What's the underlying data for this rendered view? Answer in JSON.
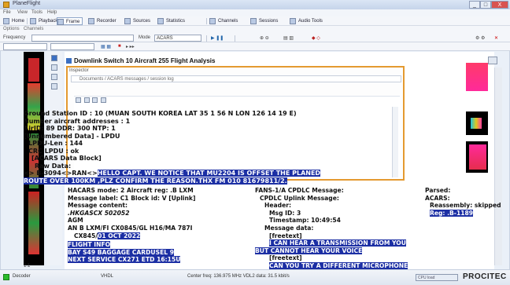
{
  "window": {
    "title": "PlaneFlight",
    "minimize": "_",
    "maximize": "□",
    "close": "X"
  },
  "menu": [
    "File",
    "View",
    "Tools",
    "Help"
  ],
  "toolbar": {
    "items": [
      "Home",
      "Playback",
      "Frame",
      "Recorder",
      "Sources",
      "Statistics",
      "Channels",
      "Sessions",
      "Audio Tools"
    ]
  },
  "toolbar2": {
    "items": [
      "Options",
      "Channels"
    ]
  },
  "toolbar3": {
    "freq_label": "Frequency",
    "mode_label": "Mode",
    "freq_value": "",
    "mode_value": "ACARS"
  },
  "toolbar4": {
    "search_placeholder": "",
    "filter_value": ""
  },
  "downlink": {
    "text": "Downlink Switch 10 Aircraft 255 Flight Analysis"
  },
  "popup": {
    "header": "Inspector",
    "path": "Documents / ACARS messages / session log"
  },
  "message": {
    "line1": "Ground Station ID : 10 (MUAN SOUTH KOREA LAT 35 1 56 N LON 126 14 19 E)",
    "line2": "Number aircraft addresses : 1",
    "line3": "AirID: 89  DDR: 300  NTP: 1",
    "line4": "[Unnumbered Data] - LPDU",
    "line5": "LPDU-Len : 144",
    "line6": "CRC LPDU : ok",
    "line7": "[ACARS Data Block]",
    "line8": "Raw Data:",
    "line9_prefix": "<> B-3094<>RAN<>",
    "line9_highlight": "HELLO CAPT. WE NOTICE THAT MU2204 IS OFFSET THE PLANED",
    "line10_highlight": "ROUTE OVER 100KM ,PLZ CONFIRM THE REASON.THX  FM 010 81679811/2."
  },
  "bottom_left": {
    "line1": "HACARS mode: 2  Aircraft reg: .B LXM",
    "line2": "Message label: C1  Block id: V  [Uplink]",
    "line3": "Message content:",
    "line4": ".HKGASCX 502052",
    "line5": "AGM",
    "line6": "AN B LXM/FI CX0845/GL H16/MA 787I",
    "line7_prefix": "CX845/",
    "line7_highlight": "01 OCT 2022",
    "line8": "FLIGHT INFO",
    "line9": "BAY S49   BAGGAGE CARDUSEL 9",
    "line10": "NEXT SERVICE CX271  ETD 16:15U"
  },
  "bottom_mid": {
    "line1": "FANS-1/A CPDLC Message:",
    "line2": "CPDLC Uplink Message:",
    "line3": "Header:",
    "line4": "Msg ID: 3",
    "line5": "Timestamp: 10:49:54",
    "line6": "Message data:",
    "line7": "[freetext]",
    "line8": "I CAN HEAR A TRANSMISSION FROM YOU",
    "line9": "BUT CANNOT HEAR YOUR VOICE",
    "line10": "[freetext]",
    "line11": "CAN YOU TRY A DIFFERENT MICROPHONE"
  },
  "bottom_right": {
    "line1": "Parsed:",
    "line2": "ACARS:",
    "line3": "Reassembly: skipped",
    "line4": "Reg: .B-1189"
  },
  "left_label": "1:1",
  "status": {
    "state": "Decoder",
    "mode": "VHDL",
    "info": "Center freq: 136.975 MHz  VDL2 data: 31.5 kbit/s",
    "progress_label": "CPU load",
    "brand": "PROCITEC"
  },
  "colors": {
    "highlight_bg": "#1c2fa4",
    "popup_border": "#e49a30",
    "status_green": "#2bbb2b"
  }
}
